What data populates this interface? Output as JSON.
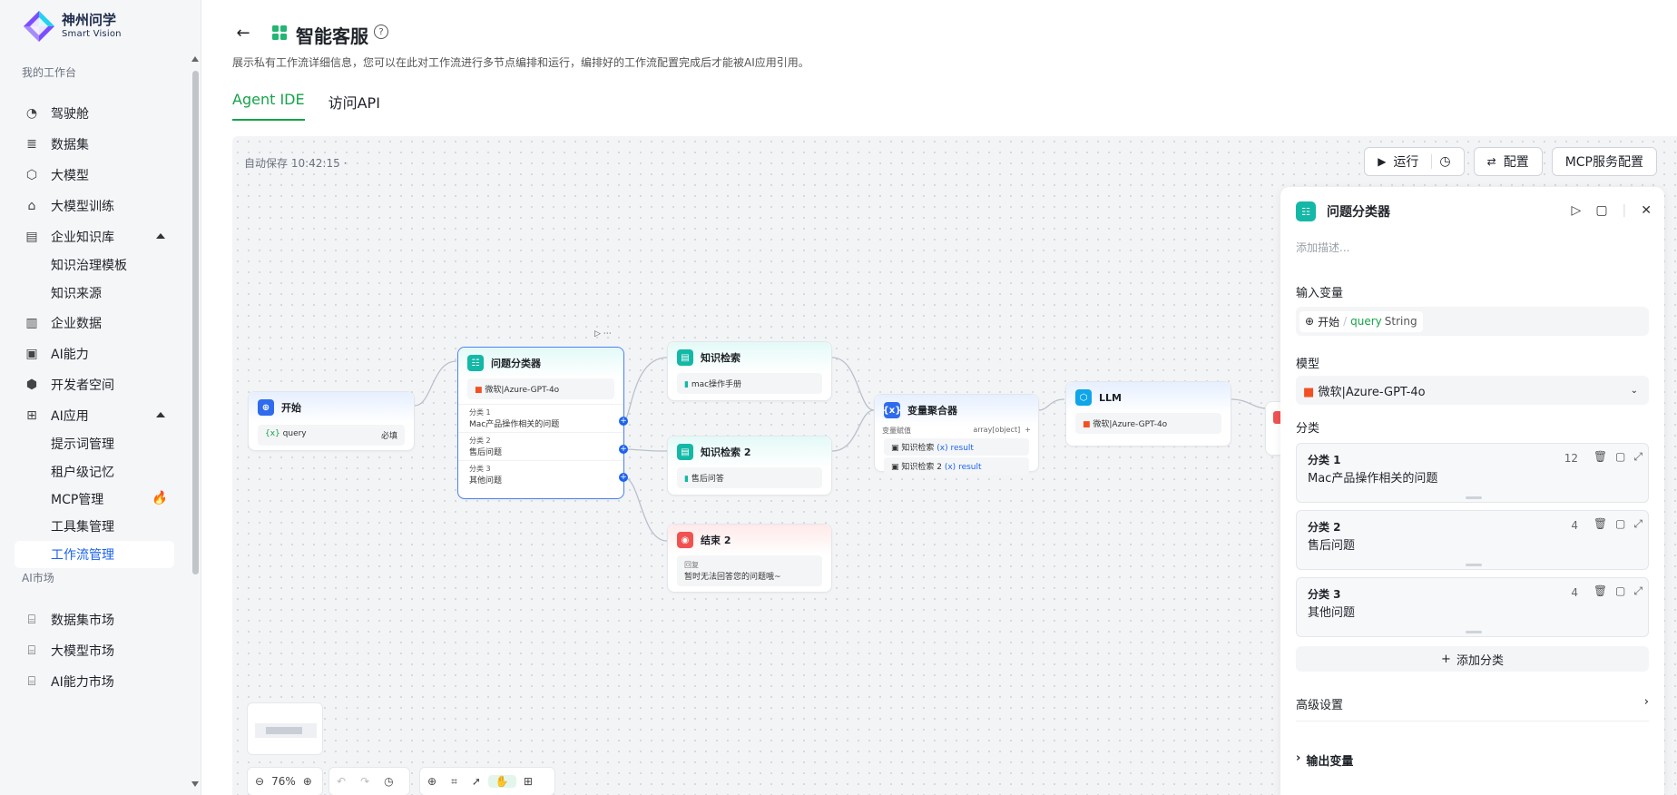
{
  "brand": {
    "title": "神州问学",
    "subtitle": "Smart Vision"
  },
  "sidebar": {
    "section_workbench": "我的工作台",
    "section_market": "AI市场",
    "items": [
      {
        "label": "驾驶舱",
        "icon": "dashboard-icon"
      },
      {
        "label": "数据集",
        "icon": "database-icon"
      },
      {
        "label": "大模型",
        "icon": "cube-icon"
      },
      {
        "label": "大模型训练",
        "icon": "training-icon"
      },
      {
        "label": "企业知识库",
        "icon": "book-icon"
      },
      {
        "label": "知识治理模板",
        "icon": ""
      },
      {
        "label": "知识来源",
        "icon": ""
      },
      {
        "label": "企业数据",
        "icon": "chart-icon"
      },
      {
        "label": "AI能力",
        "icon": "monitor-icon"
      },
      {
        "label": "开发者空间",
        "icon": "dev-icon"
      },
      {
        "label": "AI应用",
        "icon": "grid-icon"
      },
      {
        "label": "提示词管理",
        "icon": ""
      },
      {
        "label": "租户级记忆",
        "icon": ""
      },
      {
        "label": "MCP管理",
        "icon": "fire-icon"
      },
      {
        "label": "工具集管理",
        "icon": ""
      },
      {
        "label": "工作流管理",
        "icon": ""
      },
      {
        "label": "数据集市场",
        "icon": "dataset-market-icon"
      },
      {
        "label": "大模型市场",
        "icon": "model-market-icon"
      },
      {
        "label": "AI能力市场",
        "icon": "ai-market-icon"
      }
    ]
  },
  "header": {
    "title": "智能客服",
    "description": "展示私有工作流详细信息，您可以在此对工作流进行多节点编排和运行，编排好的工作流配置完成后才能被AI应用引用。",
    "tabs": [
      "Agent IDE",
      "访问API"
    ]
  },
  "canvas": {
    "autosave": "自动保存 10:42:15 ·",
    "run_label": "运行",
    "config_label": "配置",
    "mcp_label": "MCP服务配置",
    "zoom": "76%",
    "nodes": {
      "start": {
        "title": "开始",
        "var": "query",
        "required": "必填"
      },
      "classifier": {
        "title": "问题分类器",
        "model": "微软|Azure-GPT-4o",
        "cats": [
          {
            "name": "分类 1",
            "text": "Mac产品操作相关的问题"
          },
          {
            "name": "分类 2",
            "text": "售后问题"
          },
          {
            "name": "分类 3",
            "text": "其他问题"
          }
        ]
      },
      "kb1": {
        "title": "知识检索",
        "item": "mac操作手册"
      },
      "kb2": {
        "title": "知识检索 2",
        "item": "售后问答"
      },
      "end2": {
        "title": "结束 2",
        "label": "回复",
        "text": "暂时无法回答您的问题哦~"
      },
      "agg": {
        "title": "变量聚合器",
        "assign": "变量赋值",
        "type": "array[object]",
        "rows": [
          {
            "src": "知识检索",
            "var": "result"
          },
          {
            "src": "知识检索 2",
            "var": "result"
          }
        ]
      },
      "llm": {
        "title": "LLM",
        "model": "微软|Azure-GPT-4o"
      }
    }
  },
  "panel": {
    "title": "问题分类器",
    "desc_placeholder": "添加描述...",
    "input_label": "输入变量",
    "input_src": "开始",
    "input_var": "query",
    "input_type": "String",
    "model_label": "模型",
    "model_value": "微软|Azure-GPT-4o",
    "cat_label": "分类",
    "categories": [
      {
        "name": "分类 1",
        "value": "Mac产品操作相关的问题",
        "count": "12"
      },
      {
        "name": "分类 2",
        "value": "售后问题",
        "count": "4"
      },
      {
        "name": "分类 3",
        "value": "其他问题",
        "count": "4"
      }
    ],
    "add_cat": "添加分类",
    "advanced": "高级设置",
    "output": "输出变量"
  },
  "colors": {
    "accent": "#1d63ed",
    "green": "#16a34a",
    "teal": "#14b8a6",
    "red": "#f05252"
  }
}
